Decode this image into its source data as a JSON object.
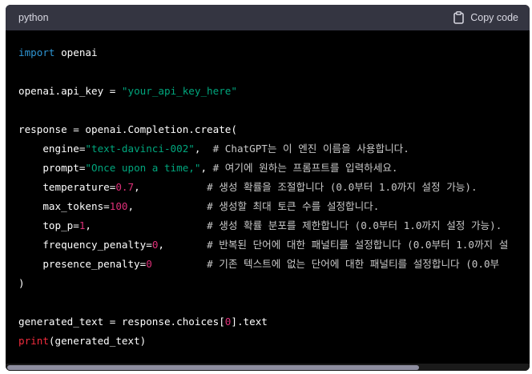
{
  "header": {
    "language": "python",
    "copy_label": "Copy code",
    "copy_icon": "clipboard-icon"
  },
  "code": {
    "l1": {
      "kw": "import",
      "rest": " openai"
    },
    "l3": {
      "a": "openai.api_key = ",
      "str": "\"your_api_key_here\""
    },
    "l5": {
      "a": "response = openai.Completion.create("
    },
    "l6": {
      "a": "    engine=",
      "str": "\"text-davinci-002\"",
      "b": ",  ",
      "cmt": "# ChatGPT는 이 엔진 이름을 사용합니다."
    },
    "l7": {
      "a": "    prompt=",
      "str": "\"Once upon a time,\"",
      "b": ", ",
      "cmt": "# 여기에 원하는 프롬프트를 입력하세요."
    },
    "l8": {
      "a": "    temperature=",
      "num": "0.7",
      "b": ",           ",
      "cmt": "# 생성 확률을 조절합니다 (0.0부터 1.0까지 설정 가능)."
    },
    "l9": {
      "a": "    max_tokens=",
      "num": "100",
      "b": ",            ",
      "cmt": "# 생성할 최대 토큰 수를 설정합니다."
    },
    "l10": {
      "a": "    top_p=",
      "num": "1",
      "b": ",                   ",
      "cmt": "# 생성 확률 분포를 제한합니다 (0.0부터 1.0까지 설정 가능)."
    },
    "l11": {
      "a": "    frequency_penalty=",
      "num": "0",
      "b": ",       ",
      "cmt": "# 반복된 단어에 대한 패널티를 설정합니다 (0.0부터 1.0까지 설"
    },
    "l12": {
      "a": "    presence_penalty=",
      "num": "0",
      "b": "         ",
      "cmt": "# 기존 텍스트에 없는 단어에 대한 패널티를 설정합니다 (0.0부"
    },
    "l13": {
      "a": ")"
    },
    "l15": {
      "a": "generated_text = response.choices[",
      "num": "0",
      "b": "].text"
    },
    "l16": {
      "fn": "print",
      "a": "(generated_text)"
    }
  },
  "colors": {
    "header_bg": "#343541",
    "code_bg": "#000000",
    "keyword": "#2e95d3",
    "string": "#00a67d",
    "number": "#df3079",
    "builtin": "#f22c3d"
  }
}
